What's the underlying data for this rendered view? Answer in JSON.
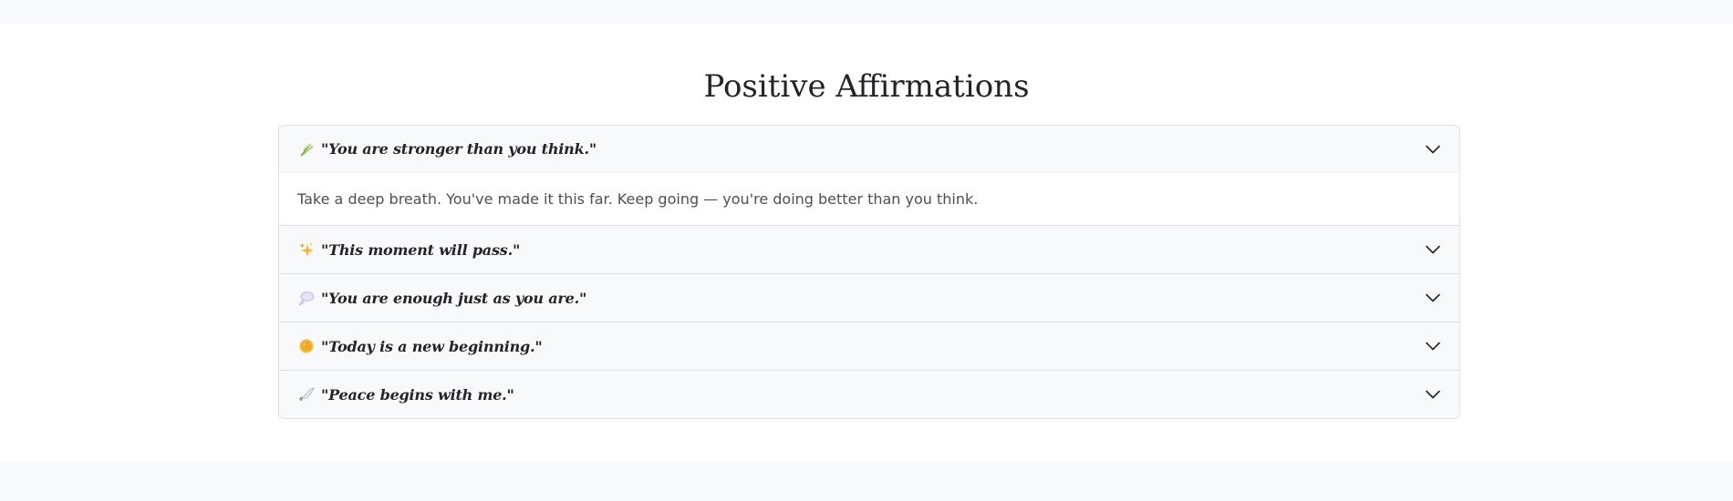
{
  "page": {
    "title": "Positive Affirmations"
  },
  "affirmations": [
    {
      "icon": "sheaf-of-rice-icon",
      "quote": "\"You are stronger than you think.\"",
      "body": "Take a deep breath. You've made it this far. Keep going — you're doing better than you think.",
      "expanded": true
    },
    {
      "icon": "sparkles-icon",
      "quote": "\"This moment will pass.\"",
      "expanded": false
    },
    {
      "icon": "thought-balloon-icon",
      "quote": "\"You are enough just as you are.\"",
      "expanded": false
    },
    {
      "icon": "sun-icon",
      "quote": "\"Today is a new beginning.\"",
      "expanded": false
    },
    {
      "icon": "dove-icon",
      "quote": "\"Peace begins with me.\"",
      "expanded": false
    }
  ],
  "colors": {
    "page_background": "#f8f9fa",
    "section_background": "#ffffff",
    "header_background": "#f8f9fa",
    "border": "#dee2e6",
    "title_text": "#212529",
    "body_text": "#495057"
  }
}
